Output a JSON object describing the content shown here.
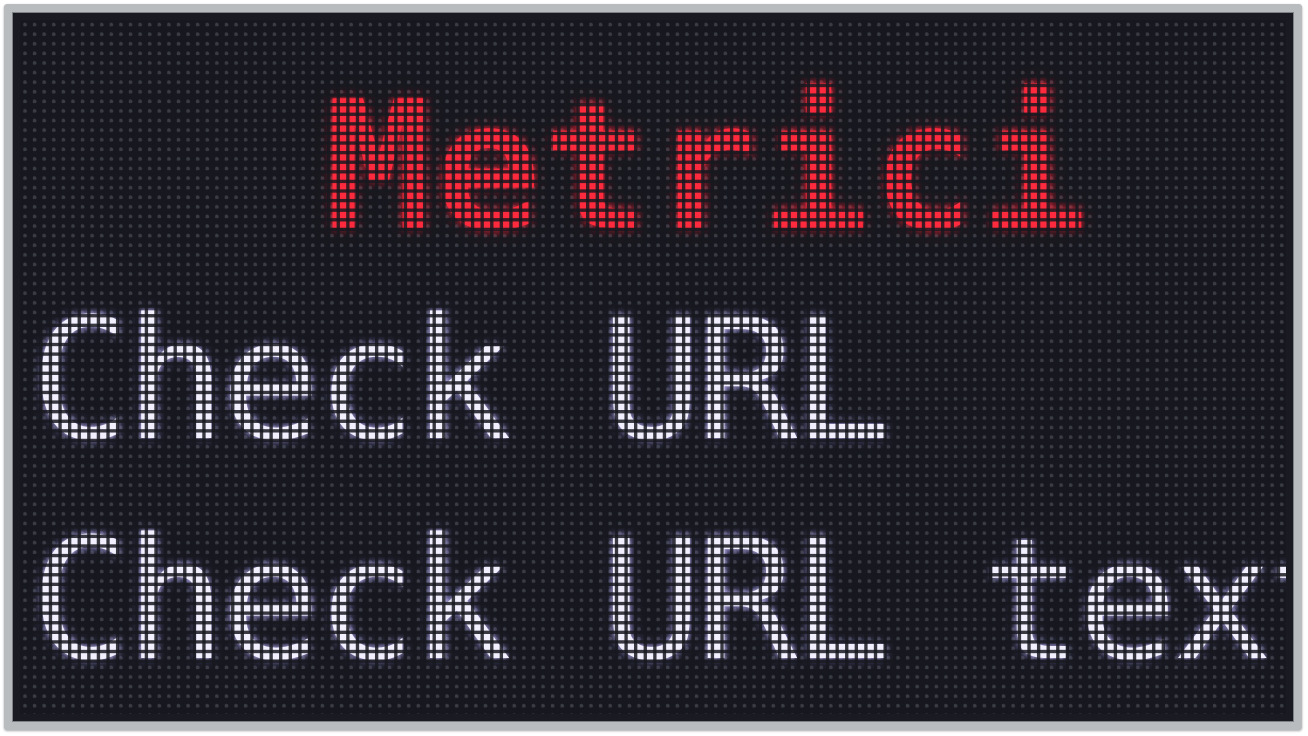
{
  "display": {
    "title": "Metrici",
    "line1": "Check URL",
    "line2": "Check URL text"
  },
  "colors": {
    "title": "#ff2a3d",
    "body_text": "#f2efff",
    "panel": "#17181f",
    "frame": "#b9bcbf"
  }
}
